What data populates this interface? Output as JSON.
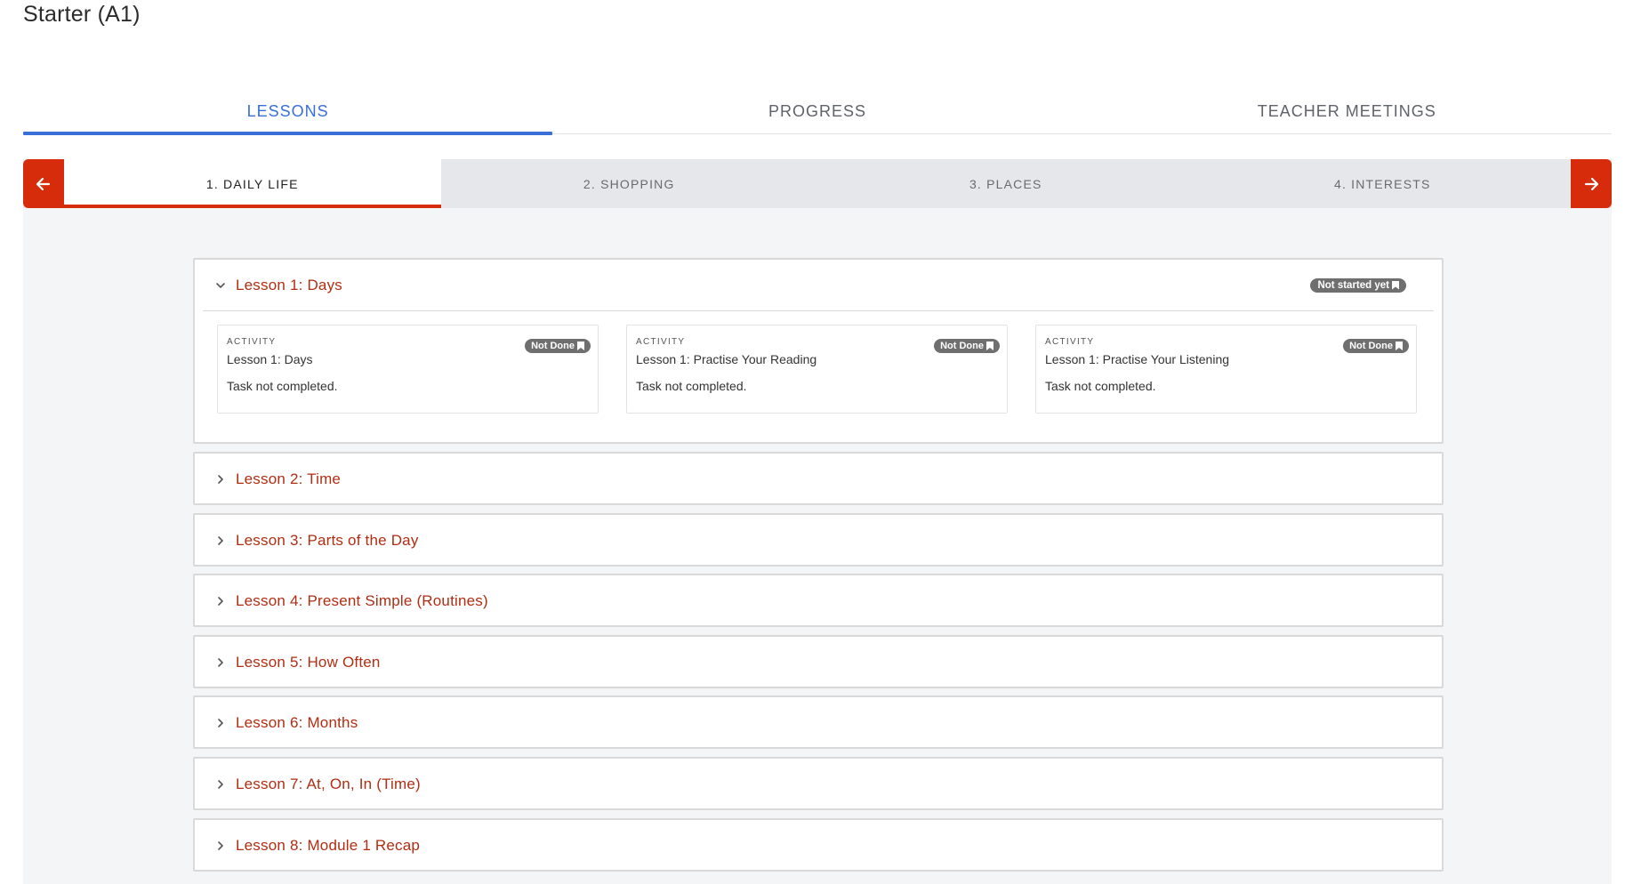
{
  "course": {
    "title": "Starter (A1)"
  },
  "main_tabs": [
    {
      "label": "LESSONS",
      "active": true
    },
    {
      "label": "PROGRESS",
      "active": false
    },
    {
      "label": "TEACHER MEETINGS",
      "active": false
    }
  ],
  "modules": {
    "prev_icon": "arrow-left-icon",
    "next_icon": "arrow-right-icon",
    "tabs": [
      {
        "label": "1. DAILY LIFE",
        "active": true
      },
      {
        "label": "2. SHOPPING",
        "active": false
      },
      {
        "label": "3. PLACES",
        "active": false
      },
      {
        "label": "4. INTERESTS",
        "active": false
      }
    ]
  },
  "lessons": [
    {
      "title": "Lesson 1: Days",
      "expanded": true,
      "status": "Not started yet",
      "activities": [
        {
          "kind": "ACTIVITY",
          "title": "Lesson 1: Days",
          "badge": "Not Done",
          "status_text": "Task not completed."
        },
        {
          "kind": "ACTIVITY",
          "title": "Lesson 1: Practise Your Reading",
          "badge": "Not Done",
          "status_text": "Task not completed."
        },
        {
          "kind": "ACTIVITY",
          "title": "Lesson 1: Practise Your Listening",
          "badge": "Not Done",
          "status_text": "Task not completed."
        }
      ]
    },
    {
      "title": "Lesson 2: Time",
      "expanded": false
    },
    {
      "title": "Lesson 3: Parts of the Day",
      "expanded": false
    },
    {
      "title": "Lesson 4: Present Simple (Routines)",
      "expanded": false
    },
    {
      "title": "Lesson 5: How Often",
      "expanded": false
    },
    {
      "title": "Lesson 6: Months",
      "expanded": false
    },
    {
      "title": "Lesson 7: At, On, In (Time)",
      "expanded": false
    },
    {
      "title": "Lesson 8: Module 1 Recap",
      "expanded": false
    }
  ],
  "colors": {
    "accent_blue": "#3b6fd8",
    "brand_red": "#d62c0c",
    "lesson_title_red": "#b22d12",
    "badge_gray": "#6f6f6f"
  }
}
